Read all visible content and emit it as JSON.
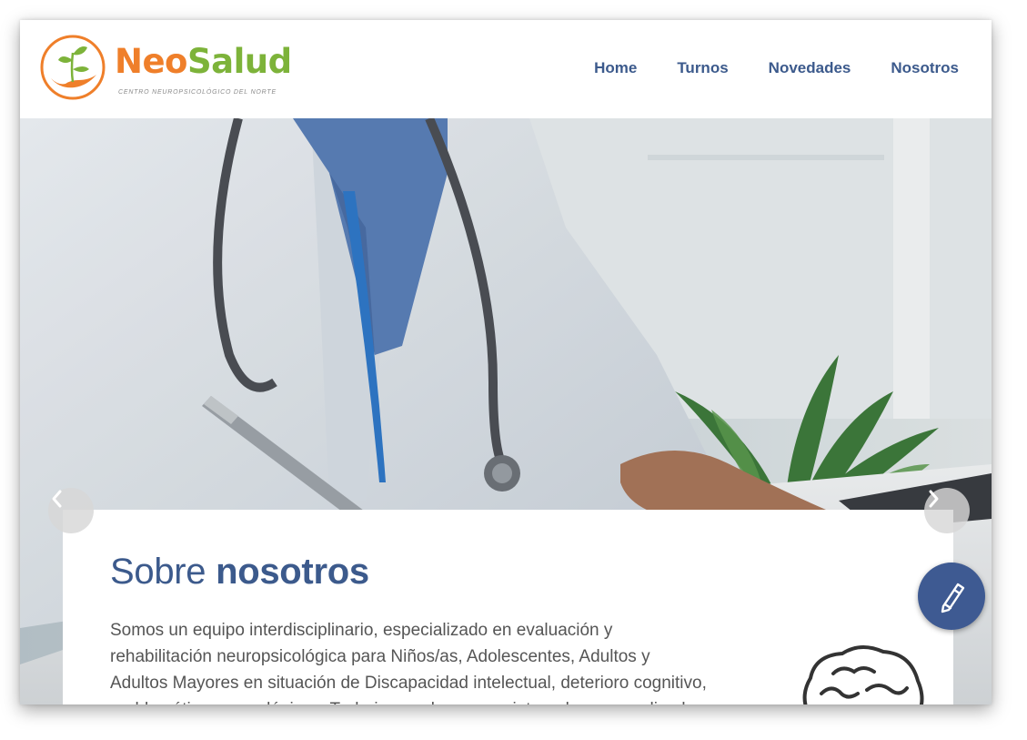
{
  "header": {
    "brand_part1": "Neo",
    "brand_part2": "Salud",
    "tagline": "CENTRO NEUROPSICOLÓGICO DEL NORTE",
    "nav": [
      "Home",
      "Turnos",
      "Novedades",
      "Nosotros"
    ]
  },
  "hero": {
    "prev_icon": "chevron-left-icon",
    "next_icon": "chevron-right-icon"
  },
  "about": {
    "title_light": "Sobre",
    "title_bold": "nosotros",
    "body": "Somos un equipo interdisciplinario, especializado en evaluación y rehabilitación neuropsicológica para Niños/as, Adolescentes, Adultos y Adultos Mayores en situación de Discapacidad intelectual, deterioro cognitivo, problemáticas neurológicas. Trabajamos de manera integral y personalizada.",
    "illustration_icon": "brain-icon"
  },
  "floating_button": {
    "icon": "pencil-icon"
  },
  "colors": {
    "nav": "#3c5a8c",
    "brand_orange": "#ef7f2a",
    "brand_green": "#7db33a",
    "fab": "#3e5a92"
  }
}
